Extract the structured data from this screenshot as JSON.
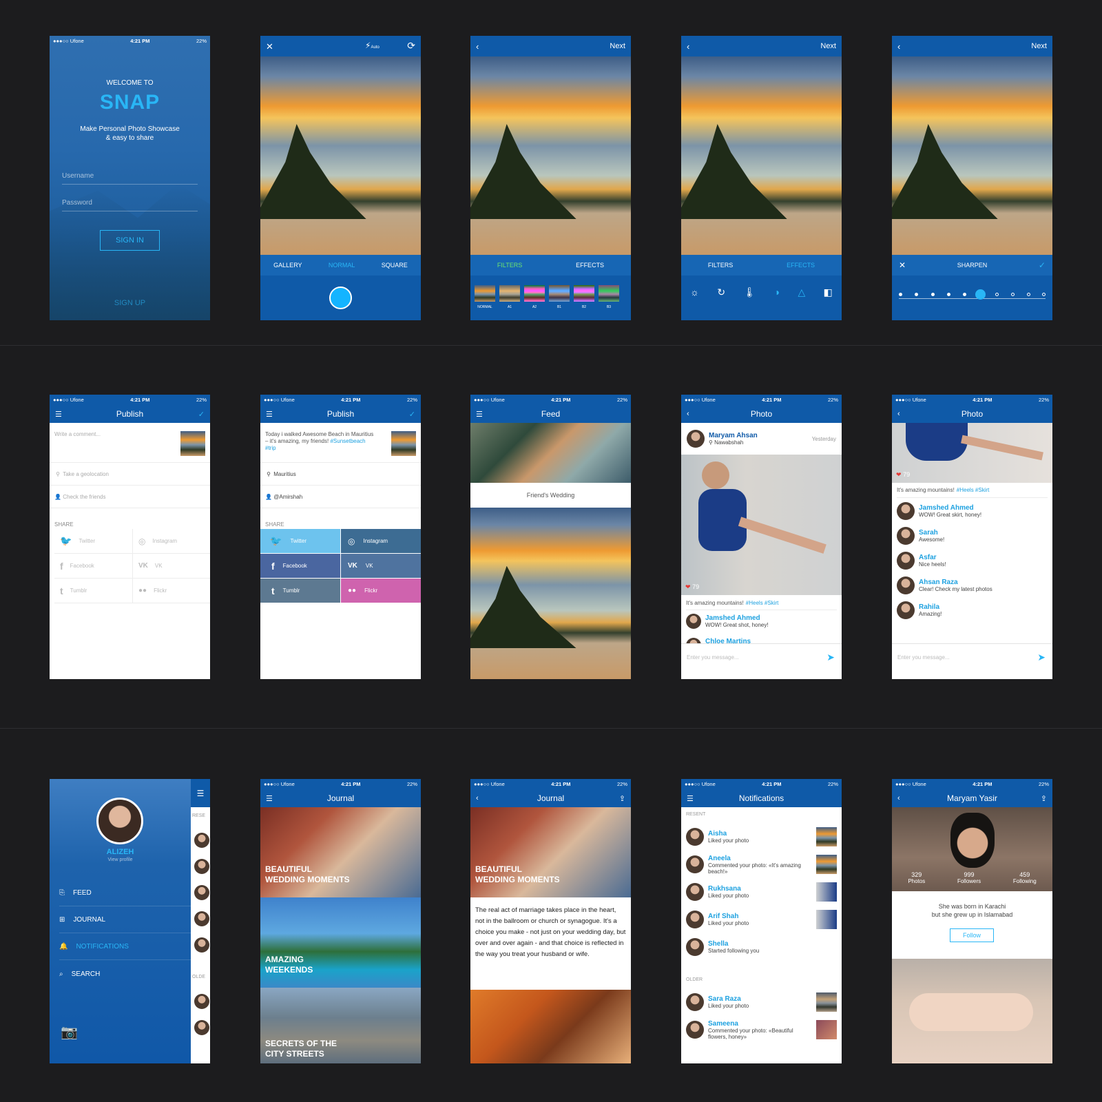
{
  "status": {
    "carrier": "●●●○○ Ufone",
    "time": "4:21 PM",
    "battery": "22%"
  },
  "welcome": {
    "pre": "WELCOME TO",
    "brand": "SNAP",
    "tagline_1": "Make Personal Photo Showcase",
    "tagline_2": "& easy to share",
    "username_placeholder": "Username",
    "password_placeholder": "Password",
    "signin": "SIGN IN",
    "signup": "SIGN UP"
  },
  "camera": {
    "flash": "Auto",
    "tabs": [
      "GALLERY",
      "NORMAL",
      "SQUARE"
    ]
  },
  "edit": {
    "next": "Next",
    "filters": "FILTERS",
    "effects": "EFFECTS",
    "filter_names": [
      "NORMAL",
      "A1",
      "A2",
      "B1",
      "B2",
      "B3"
    ],
    "sharpen": "SHARPEN"
  },
  "publish": {
    "title": "Publish",
    "comment_placeholder": "Write a comment...",
    "geo_placeholder": "Take a geolocation",
    "friends_placeholder": "Check the friends",
    "share": "SHARE",
    "networks": [
      "Twitter",
      "Instagram",
      "Facebook",
      "VK",
      "Tumblr",
      "Flickr"
    ],
    "filled_comment": "Today i walked Awesome Beach in Mauritius – it's amazing, my friends!",
    "filled_tags": "#Sunsetbeach #trip",
    "location": "Mauritius",
    "friend": "@Amirshah"
  },
  "feed": {
    "title": "Feed",
    "caption": "Friend's Wedding"
  },
  "photo": {
    "title": "Photo",
    "author": "Maryam Ahsan",
    "place": "Nawabshah",
    "when": "Yesterday",
    "likes": "79",
    "caption": "It's amazing mountains!",
    "tags": "#Heels #Skirt",
    "input_placeholder": "Enter you message...",
    "comments_a": [
      {
        "name": "Jamshed Ahmed",
        "text": "WOW! Great shot, honey!"
      },
      {
        "name": "Chloe Martins",
        "text": ""
      }
    ],
    "comments_b": [
      {
        "name": "Jamshed Ahmed",
        "text": "WOW! Great skirt, honey!"
      },
      {
        "name": "Sarah",
        "text": "Awesome!"
      },
      {
        "name": "Asfar",
        "text": "Nice heels!"
      },
      {
        "name": "Ahsan Raza",
        "text": "Clear! Check my latest photos"
      },
      {
        "name": "Rahila",
        "text": "Amazing!"
      }
    ]
  },
  "menu": {
    "name": "ALIZEH",
    "view": "View profile",
    "items": [
      "FEED",
      "JOURNAL",
      "NOTIFICATIONS",
      "SEARCH"
    ],
    "resent": "RESE",
    "older": "OLDE"
  },
  "journal": {
    "title": "Journal",
    "stories": [
      {
        "l1": "BEAUTIFUL",
        "l2": "WEDDING MOMENTS"
      },
      {
        "l1": "AMAZING",
        "l2": "WEEKENDS"
      },
      {
        "l1": "SECRETS OF THE",
        "l2": "CITY STREETS"
      }
    ],
    "body": "The real act of marriage takes place in the heart, not in the ballroom or church or synagogue. It's a choice you make - not just on your wedding day, but over and over again - and that choice is reflected in the way you treat your husband or wife."
  },
  "notifications": {
    "title": "Notifications",
    "resent": "RESENT",
    "older": "OLDER",
    "items": [
      {
        "name": "Aisha",
        "text": "Liked your photo"
      },
      {
        "name": "Aneela",
        "text": "Commented your photo: «It's amazing beach!»"
      },
      {
        "name": "Rukhsana",
        "text": "Liked your photo"
      },
      {
        "name": "Arif Shah",
        "text": "Liked your photo"
      },
      {
        "name": "Shella",
        "text": "Started following you"
      }
    ],
    "older_items": [
      {
        "name": "Sara Raza",
        "text": "Liked your photo"
      },
      {
        "name": "Sameena",
        "text": "Commented your photo: «Beautiful flowers, honey»"
      }
    ]
  },
  "profile": {
    "name": "Maryam Yasir",
    "stats": [
      {
        "n": "329",
        "l": "Photos"
      },
      {
        "n": "999",
        "l": "Followers"
      },
      {
        "n": "459",
        "l": "Following"
      }
    ],
    "bio_1": "She was born in Karachi",
    "bio_2": "but she grew up in Islamabad",
    "follow": "Follow"
  },
  "colors": {
    "primary": "#0f5aa8",
    "accent": "#29b6f6",
    "background": "#1c1c1e"
  }
}
